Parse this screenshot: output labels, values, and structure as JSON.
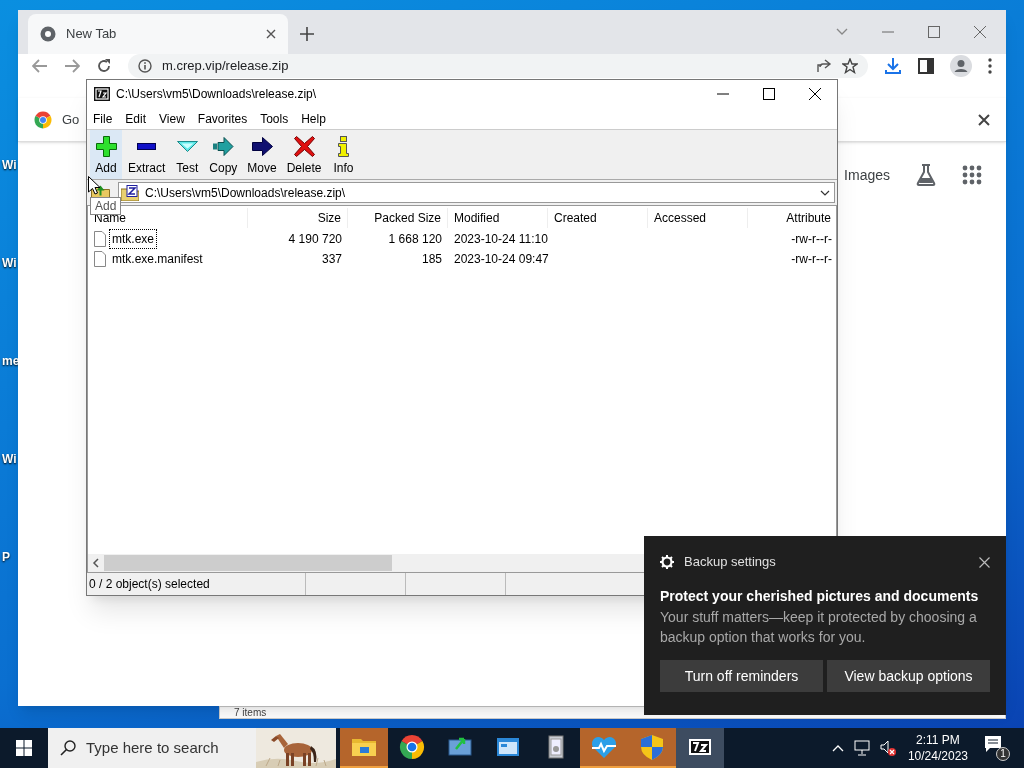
{
  "desktop_icons": [
    {
      "label": "Wi"
    },
    {
      "label": "Wi"
    },
    {
      "label": "me"
    },
    {
      "label": "Wi"
    },
    {
      "label": "P"
    }
  ],
  "browser": {
    "tab_title": "New Tab",
    "address": "m.crep.vip/release.zip",
    "infobar_text": "Go",
    "links": [
      "Images"
    ]
  },
  "background_window": {
    "status_text": "7 items"
  },
  "archive_window": {
    "title": "C:\\Users\\vm5\\Downloads\\release.zip\\",
    "menu": [
      "File",
      "Edit",
      "View",
      "Favorites",
      "Tools",
      "Help"
    ],
    "toolbar": [
      {
        "label": "Add",
        "kind": "add",
        "hovered": true
      },
      {
        "label": "Extract",
        "kind": "extract",
        "hovered": false
      },
      {
        "label": "Test",
        "kind": "test",
        "hovered": false
      },
      {
        "label": "Copy",
        "kind": "copy",
        "hovered": false
      },
      {
        "label": "Move",
        "kind": "move",
        "hovered": false
      },
      {
        "label": "Delete",
        "kind": "delete",
        "hovered": false
      },
      {
        "label": "Info",
        "kind": "info",
        "hovered": false
      }
    ],
    "tooltip": "Add",
    "path": "C:\\Users\\vm5\\Downloads\\release.zip\\",
    "columns": [
      "Name",
      "Size",
      "Packed Size",
      "Modified",
      "Created",
      "Accessed",
      "Attribute"
    ],
    "rows": [
      {
        "name": "mtk.exe",
        "size": "4 190 720",
        "packed_size": "1 668 120",
        "modified": "2023-10-24 11:10",
        "attributes": "-rw-r--r-",
        "focused": true
      },
      {
        "name": "mtk.exe.manifest",
        "size": "337",
        "packed_size": "185",
        "modified": "2023-10-24 09:47",
        "attributes": "-rw-r--r-",
        "focused": false
      }
    ],
    "status_bar": [
      "0 / 2 object(s) selected"
    ]
  },
  "notification": {
    "source": "Backup settings",
    "title": "Protect your cherished pictures and documents",
    "body": "Your stuff matters—keep it protected by choosing a backup option that works for you.",
    "buttons": [
      "Turn off reminders",
      "View backup options"
    ]
  },
  "taskbar": {
    "search_placeholder": "Type here to search",
    "apps": [
      {
        "kind": "explorer",
        "flashing": true,
        "active": false
      },
      {
        "kind": "chrome",
        "flashing": false,
        "active": false
      },
      {
        "kind": "transfer",
        "flashing": false,
        "active": false
      },
      {
        "kind": "window",
        "flashing": false,
        "active": false
      },
      {
        "kind": "document",
        "flashing": false,
        "active": false
      },
      {
        "kind": "health",
        "flashing": true,
        "active": false
      },
      {
        "kind": "shield",
        "flashing": true,
        "active": false
      },
      {
        "kind": "archiver",
        "flashing": false,
        "active": true
      }
    ],
    "clock": {
      "time": "2:11 PM",
      "date": "10/24/2023"
    },
    "notification_count": "1"
  }
}
